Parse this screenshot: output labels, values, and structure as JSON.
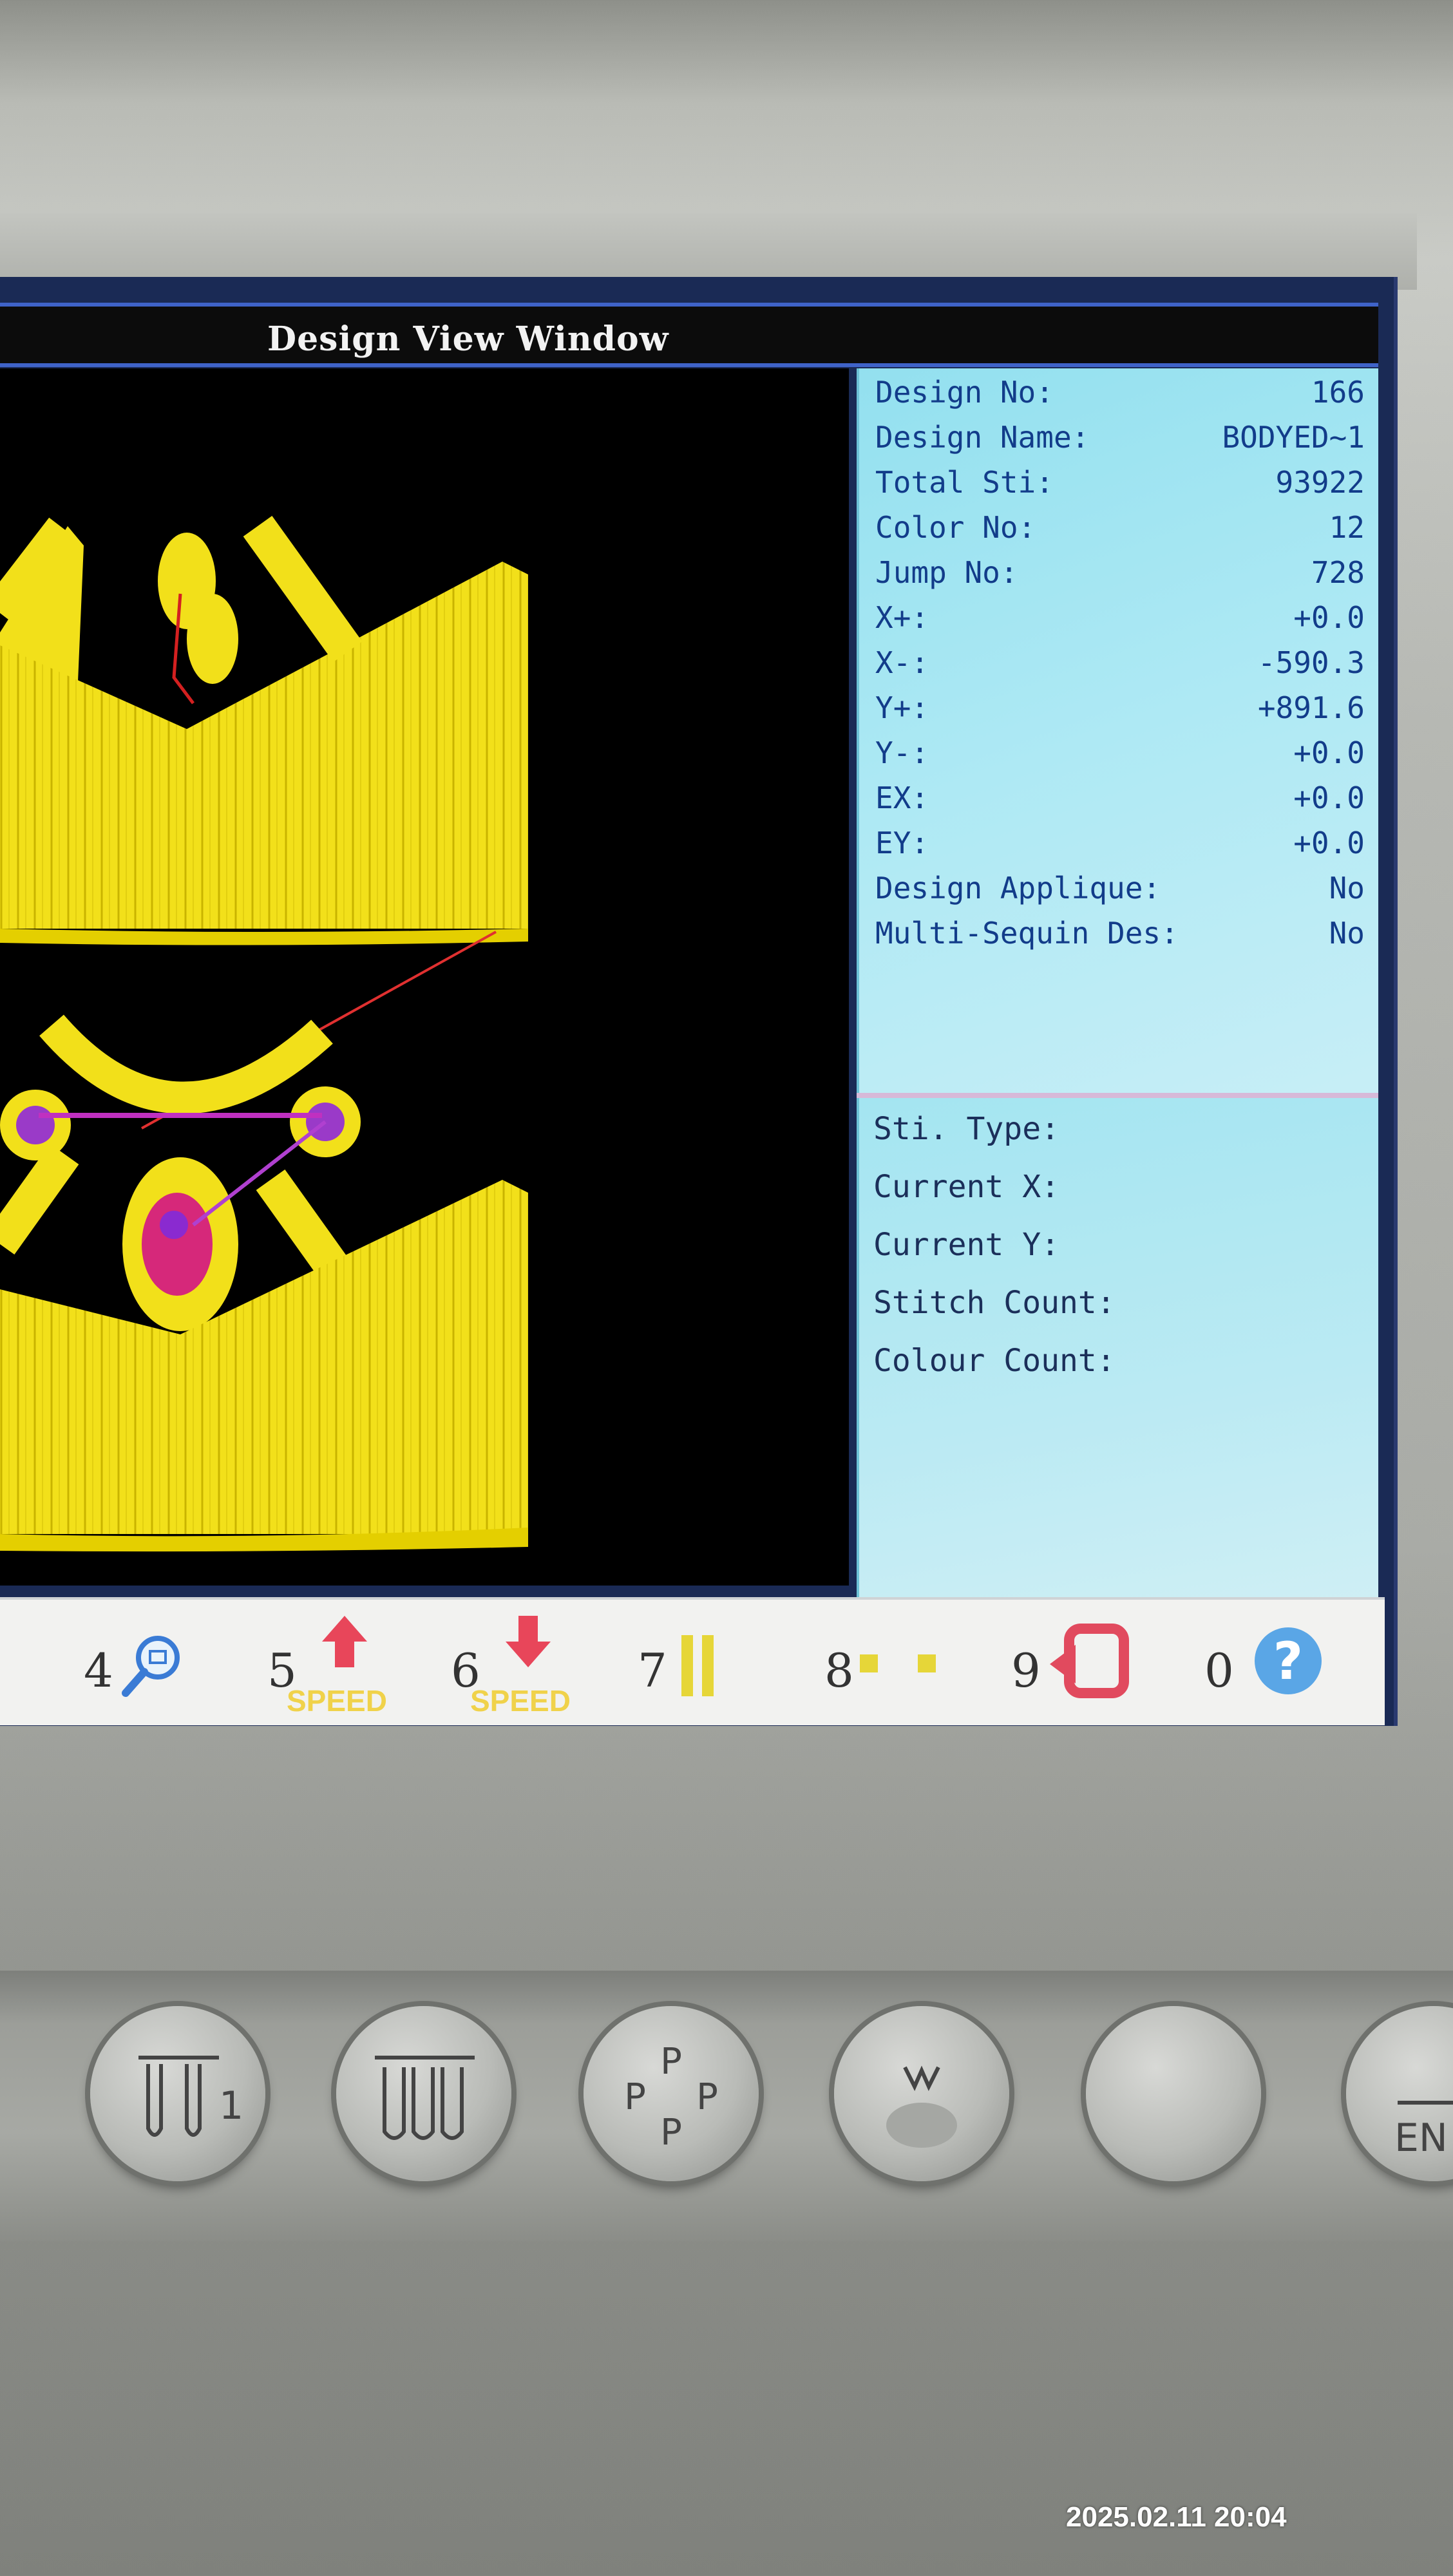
{
  "window": {
    "title": "Design View Window"
  },
  "design_info": [
    {
      "label": "Design No:",
      "value": "166"
    },
    {
      "label": "Design Name:",
      "value": "BODYED~1"
    },
    {
      "label": "Total Sti:",
      "value": "93922"
    },
    {
      "label": "Color No:",
      "value": "12"
    },
    {
      "label": "Jump No:",
      "value": "728"
    },
    {
      "label": "X+:",
      "value": "+0.0"
    },
    {
      "label": "X-:",
      "value": "-590.3"
    },
    {
      "label": "Y+:",
      "value": "+891.6"
    },
    {
      "label": "Y-:",
      "value": "+0.0"
    },
    {
      "label": "EX:",
      "value": "+0.0"
    },
    {
      "label": "EY:",
      "value": "+0.0"
    },
    {
      "label": "Design Applique:",
      "value": "No"
    },
    {
      "label": "Multi-Sequin Des:",
      "value": "No"
    }
  ],
  "stitch_status": [
    {
      "label": "Sti. Type:"
    },
    {
      "label": "Current X:"
    },
    {
      "label": "Current Y:"
    },
    {
      "label": "Stitch Count:"
    },
    {
      "label": "Colour Count:"
    }
  ],
  "function_keys": [
    {
      "num": "4",
      "icon": "zoom-icon"
    },
    {
      "num": "5",
      "icon": "speed-up-icon",
      "caption": "SPEED"
    },
    {
      "num": "6",
      "icon": "speed-down-icon",
      "caption": "SPEED"
    },
    {
      "num": "7",
      "icon": "pause-icon"
    },
    {
      "num": "8",
      "icon": "frame-trace-icon"
    },
    {
      "num": "9",
      "icon": "return-icon"
    },
    {
      "num": "0",
      "icon": "help-icon"
    }
  ],
  "hardware_buttons": [
    {
      "icon": "needle-left-icon"
    },
    {
      "icon": "needle-three-icon"
    },
    {
      "icon": "cycle-p-icon"
    },
    {
      "icon": "menu-m-icon"
    },
    {
      "icon": "blank-icon"
    },
    {
      "icon": "enter-icon",
      "label": "EN"
    }
  ],
  "photo_timestamp": "2025.02.11 20:04",
  "colors": {
    "design_yellow": "#f2e01a",
    "panel_cyan": "#aee9f4",
    "panel_text": "#123c8a",
    "title_border": "#3f63c9",
    "speed_caption": "#f0d24a"
  }
}
